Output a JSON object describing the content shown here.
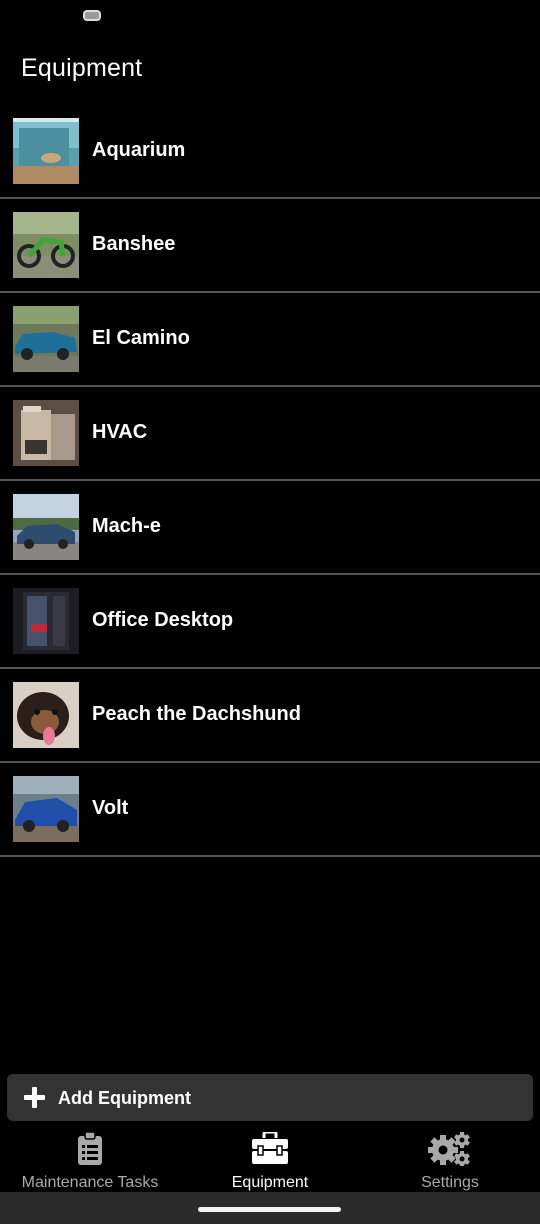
{
  "header": {
    "title": "Equipment"
  },
  "equipment": [
    {
      "name": "Aquarium",
      "thumbnail": "aquarium-photo"
    },
    {
      "name": "Banshee",
      "thumbnail": "dirt-bike-photo"
    },
    {
      "name": "El Camino",
      "thumbnail": "blue-classic-car-photo"
    },
    {
      "name": "HVAC",
      "thumbnail": "furnace-photo"
    },
    {
      "name": "Mach-e",
      "thumbnail": "blue-suv-photo"
    },
    {
      "name": "Office Desktop",
      "thumbnail": "pc-tower-photo"
    },
    {
      "name": "Peach the Dachshund",
      "thumbnail": "dachshund-photo"
    },
    {
      "name": "Volt",
      "thumbnail": "blue-hatchback-photo"
    }
  ],
  "actions": {
    "add_label": "Add Equipment",
    "add_icon": "plus-icon"
  },
  "tabs": [
    {
      "label": "Maintenance Tasks",
      "icon": "clipboard-icon",
      "active": false
    },
    {
      "label": "Equipment",
      "icon": "toolbox-icon",
      "active": true
    },
    {
      "label": "Settings",
      "icon": "gears-icon",
      "active": false
    }
  ],
  "colors": {
    "background": "#000000",
    "divider": "#555555",
    "button": "#333333",
    "active_tab": "#ffffff",
    "inactive_tab": "#a9a9a9"
  }
}
